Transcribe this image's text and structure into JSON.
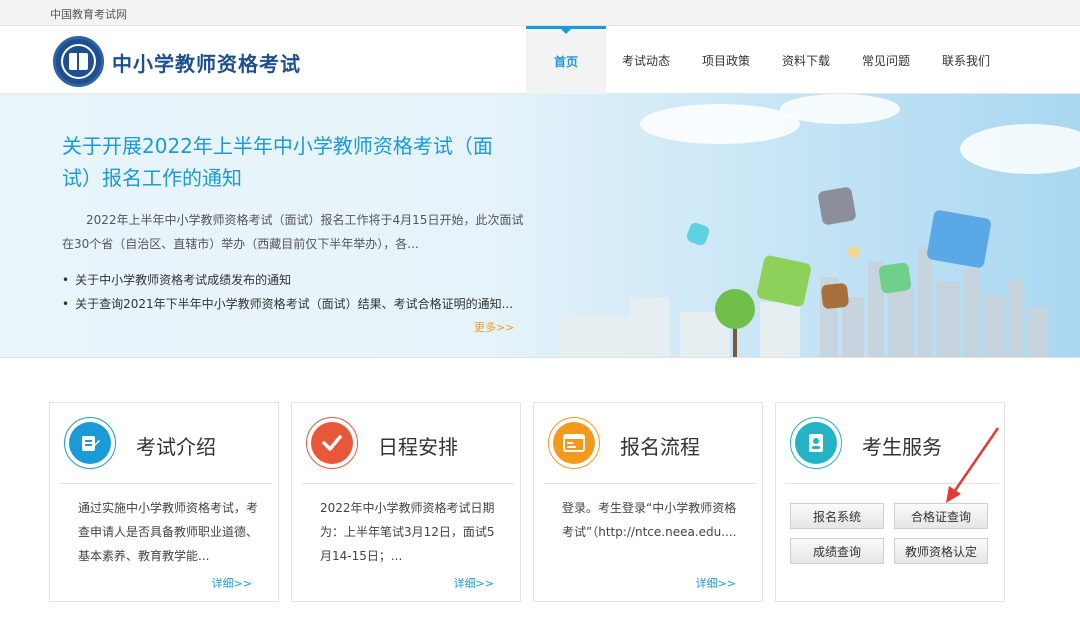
{
  "topbar": {
    "site_name": "中国教育考试网"
  },
  "header": {
    "logo_title": "中小学教师资格考试"
  },
  "nav": {
    "items": [
      {
        "label": "首页",
        "active": true
      },
      {
        "label": "考试动态",
        "active": false
      },
      {
        "label": "项目政策",
        "active": false
      },
      {
        "label": "资料下载",
        "active": false
      },
      {
        "label": "常见问题",
        "active": false
      },
      {
        "label": "联系我们",
        "active": false
      }
    ]
  },
  "banner": {
    "title": "关于开展2022年上半年中小学教师资格考试（面试）报名工作的通知",
    "summary": "2022年上半年中小学教师资格考试（面试）报名工作将于4月15日开始，此次面试在30个省（自治区、直辖市）举办（西藏目前仅下半年举办），各...",
    "links": [
      "关于中小学教师资格考试成绩发布的通知",
      "关于查询2021年下半年中小学教师资格考试（面试）结果、考试合格证明的通知..."
    ],
    "more": "更多>>"
  },
  "cards": [
    {
      "title": "考试介绍",
      "icon": "document-edit-icon",
      "color": "#1a9ad6",
      "text": "通过实施中小学教师资格考试，考查申请人是否具备教师职业道德、基本素养、教育教学能...",
      "more": "详细>>"
    },
    {
      "title": "日程安排",
      "icon": "checkmark-icon",
      "color": "#e8573a",
      "text": "2022年中小学教师资格考试日期为：上半年笔试3月12日，面试5月14-15日；...",
      "more": "详细>>"
    },
    {
      "title": "报名流程",
      "icon": "registration-form-icon",
      "color": "#f39a1e",
      "text": "登录。考生登录“中小学教师资格考试”（http://ntce.neea.edu....",
      "more": "详细>>"
    },
    {
      "title": "考生服务",
      "icon": "address-book-icon",
      "color": "#23b3c4"
    }
  ],
  "services": {
    "buttons": [
      "报名系统",
      "合格证查询",
      "成绩查询",
      "教师资格认定"
    ]
  },
  "colors": {
    "accent": "#1a9ad6",
    "orange": "#f39a1e",
    "red": "#e8573a",
    "teal": "#23b3c4",
    "annotation_arrow": "#e53935"
  }
}
